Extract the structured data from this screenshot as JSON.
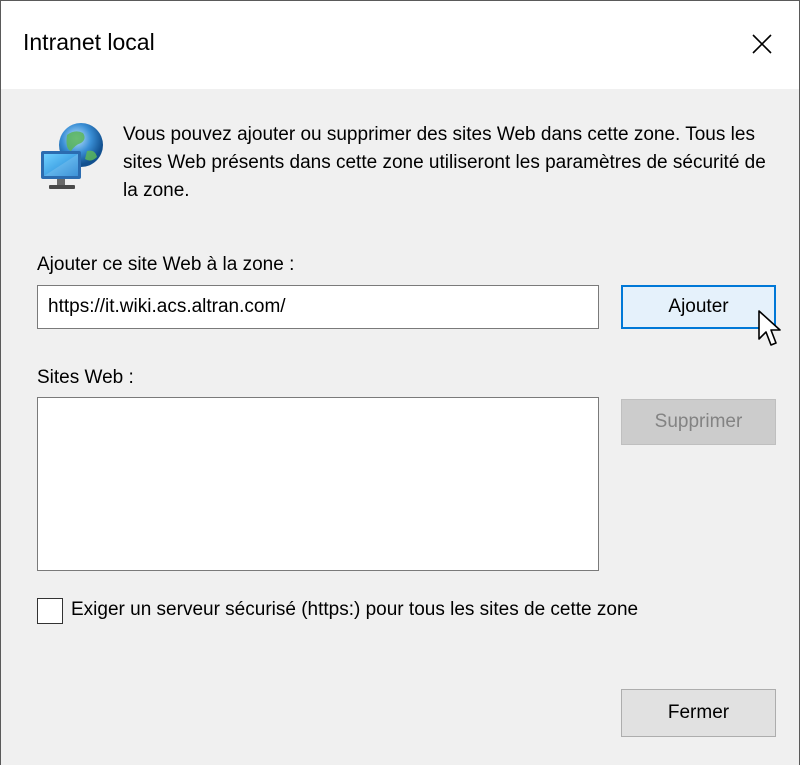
{
  "window": {
    "title": "Intranet local",
    "close_glyph": "✕"
  },
  "description": "Vous pouvez ajouter ou supprimer des sites Web dans cette zone. Tous les sites Web présents dans cette zone utiliseront les paramètres de sécurité de la zone.",
  "add_section": {
    "label": "Ajouter ce site Web à la zone :",
    "input_value": "https://it.wiki.acs.altran.com/",
    "add_button": "Ajouter"
  },
  "sites_section": {
    "label": "Sites Web :",
    "items": [],
    "remove_button": "Supprimer"
  },
  "https_option": {
    "label": "Exiger un serveur sécurisé (https:) pour tous les sites de cette zone",
    "checked": false
  },
  "footer": {
    "close_button": "Fermer"
  },
  "icons": {
    "zone_icon": "globe-computer-icon",
    "close_icon": "close-icon",
    "cursor": "mouse-pointer"
  },
  "colors": {
    "accent_border": "#0078d7",
    "accent_fill": "#e5f1fb",
    "disabled_text": "#838383"
  }
}
